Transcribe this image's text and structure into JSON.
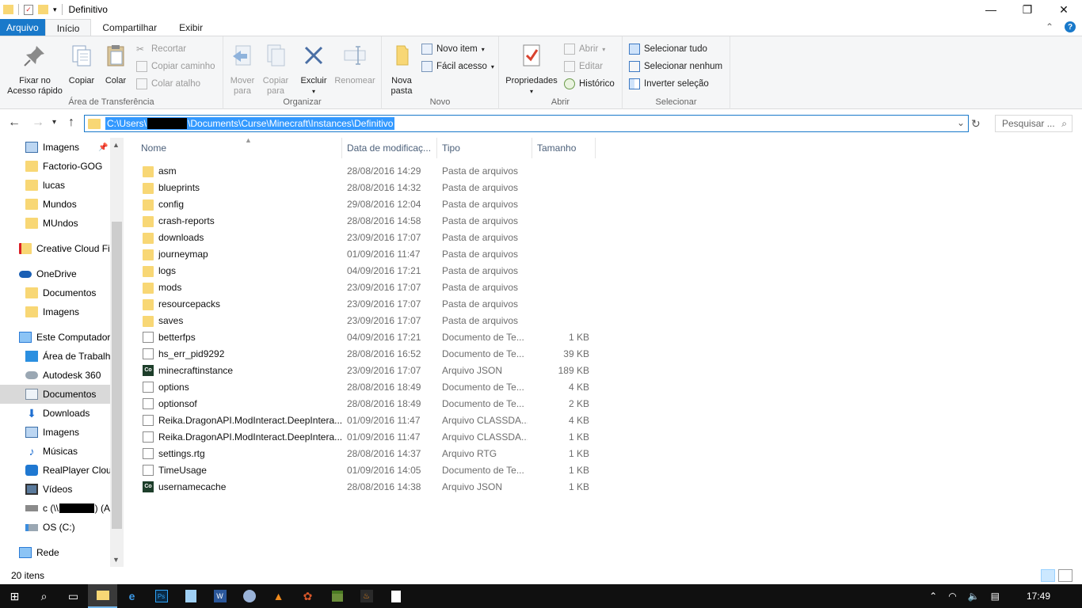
{
  "window": {
    "title": "Definitivo",
    "minimize": "—",
    "maximize": "❐",
    "close": "✕"
  },
  "tabs": [
    {
      "label": "Arquivo"
    },
    {
      "label": "Início"
    },
    {
      "label": "Compartilhar"
    },
    {
      "label": "Exibir"
    }
  ],
  "ribbon": {
    "clipboard": {
      "label": "Área de Transferência",
      "pin": "Fixar no\nAcesso rápido",
      "copy": "Copiar",
      "paste": "Colar",
      "cut": "Recortar",
      "copy_path": "Copiar caminho",
      "paste_shortcut": "Colar atalho"
    },
    "organize": {
      "label": "Organizar",
      "move_to": "Mover\npara",
      "copy_to": "Copiar\npara",
      "delete": "Excluir",
      "rename": "Renomear"
    },
    "new": {
      "label": "Novo",
      "new_folder": "Nova\npasta",
      "new_item": "Novo item",
      "easy_access": "Fácil acesso"
    },
    "open": {
      "label": "Abrir",
      "properties": "Propriedades",
      "open": "Abrir",
      "edit": "Editar",
      "history": "Histórico"
    },
    "select": {
      "label": "Selecionar",
      "select_all": "Selecionar tudo",
      "select_none": "Selecionar nenhum",
      "invert": "Inverter seleção"
    }
  },
  "address": {
    "path_part1": "C:\\Users\\",
    "path_part2": "\\Documents\\Curse\\Minecraft\\Instances\\Definitivo",
    "search_placeholder": "Pesquisar ..."
  },
  "nav": {
    "items": [
      {
        "label": "Imagens"
      },
      {
        "label": "Factorio-GOG"
      },
      {
        "label": "lucas"
      },
      {
        "label": "Mundos"
      },
      {
        "label": "MUndos"
      },
      {
        "label": "Creative Cloud Fil"
      },
      {
        "label": "OneDrive"
      },
      {
        "label": "Documentos"
      },
      {
        "label": "Imagens"
      },
      {
        "label": "Este Computador"
      },
      {
        "label": "Área de Trabalho"
      },
      {
        "label": "Autodesk 360"
      },
      {
        "label": "Documentos"
      },
      {
        "label": "Downloads"
      },
      {
        "label": "Imagens"
      },
      {
        "label": "Músicas"
      },
      {
        "label": "RealPlayer Cloud"
      },
      {
        "label": "Vídeos"
      },
      {
        "label": "c (\\\\"
      },
      {
        "label": "OS (C:)"
      },
      {
        "label": "Rede"
      }
    ]
  },
  "columns": {
    "name": "Nome",
    "date": "Data de modificaç...",
    "type": "Tipo",
    "size": "Tamanho"
  },
  "files": [
    {
      "name": "asm",
      "date": "28/08/2016 14:29",
      "type": "Pasta de arquivos",
      "size": "",
      "icon": "folder"
    },
    {
      "name": "blueprints",
      "date": "28/08/2016 14:32",
      "type": "Pasta de arquivos",
      "size": "",
      "icon": "folder"
    },
    {
      "name": "config",
      "date": "29/08/2016 12:04",
      "type": "Pasta de arquivos",
      "size": "",
      "icon": "folder"
    },
    {
      "name": "crash-reports",
      "date": "28/08/2016 14:58",
      "type": "Pasta de arquivos",
      "size": "",
      "icon": "folder"
    },
    {
      "name": "downloads",
      "date": "23/09/2016 17:07",
      "type": "Pasta de arquivos",
      "size": "",
      "icon": "folder"
    },
    {
      "name": "journeymap",
      "date": "01/09/2016 11:47",
      "type": "Pasta de arquivos",
      "size": "",
      "icon": "folder"
    },
    {
      "name": "logs",
      "date": "04/09/2016 17:21",
      "type": "Pasta de arquivos",
      "size": "",
      "icon": "folder"
    },
    {
      "name": "mods",
      "date": "23/09/2016 17:07",
      "type": "Pasta de arquivos",
      "size": "",
      "icon": "folder"
    },
    {
      "name": "resourcepacks",
      "date": "23/09/2016 17:07",
      "type": "Pasta de arquivos",
      "size": "",
      "icon": "folder"
    },
    {
      "name": "saves",
      "date": "23/09/2016 17:07",
      "type": "Pasta de arquivos",
      "size": "",
      "icon": "folder"
    },
    {
      "name": "betterfps",
      "date": "04/09/2016 17:21",
      "type": "Documento de Te...",
      "size": "1 KB",
      "icon": "doc"
    },
    {
      "name": "hs_err_pid9292",
      "date": "28/08/2016 16:52",
      "type": "Documento de Te...",
      "size": "39 KB",
      "icon": "doc"
    },
    {
      "name": "minecraftinstance",
      "date": "23/09/2016 17:07",
      "type": "Arquivo JSON",
      "size": "189 KB",
      "icon": "json"
    },
    {
      "name": "options",
      "date": "28/08/2016 18:49",
      "type": "Documento de Te...",
      "size": "4 KB",
      "icon": "doc"
    },
    {
      "name": "optionsof",
      "date": "28/08/2016 18:49",
      "type": "Documento de Te...",
      "size": "2 KB",
      "icon": "doc"
    },
    {
      "name": "Reika.DragonAPI.ModInteract.DeepIntera...",
      "date": "01/09/2016 11:47",
      "type": "Arquivo CLASSDA...",
      "size": "4 KB",
      "icon": "doc"
    },
    {
      "name": "Reika.DragonAPI.ModInteract.DeepIntera...",
      "date": "01/09/2016 11:47",
      "type": "Arquivo CLASSDA...",
      "size": "1 KB",
      "icon": "doc"
    },
    {
      "name": "settings.rtg",
      "date": "28/08/2016 14:37",
      "type": "Arquivo RTG",
      "size": "1 KB",
      "icon": "doc"
    },
    {
      "name": "TimeUsage",
      "date": "01/09/2016 14:05",
      "type": "Documento de Te...",
      "size": "1 KB",
      "icon": "doc"
    },
    {
      "name": "usernamecache",
      "date": "28/08/2016 14:38",
      "type": "Arquivo JSON",
      "size": "1 KB",
      "icon": "json"
    }
  ],
  "status": {
    "count": "20 itens"
  },
  "taskbar": {
    "clock": "17:49"
  }
}
